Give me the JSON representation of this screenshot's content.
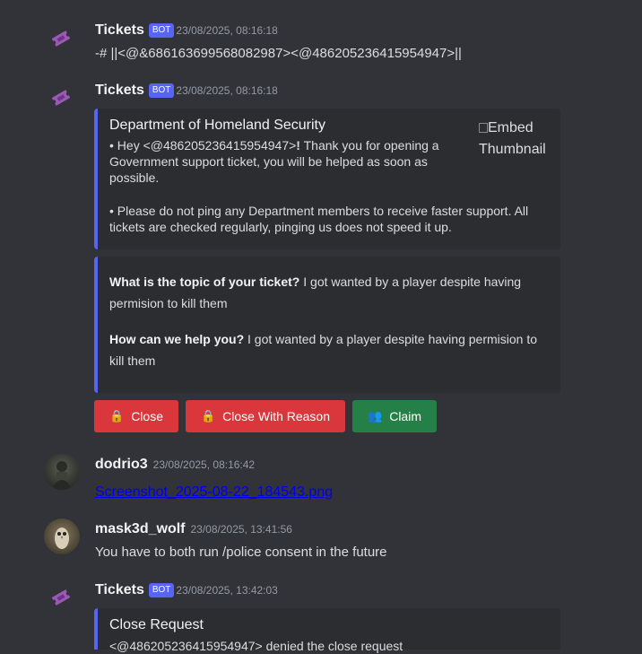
{
  "messages": [
    {
      "author": "Tickets",
      "bot_badge": "BOT",
      "timestamp": "23/08/2025, 08:16:18",
      "text": "-# ||<@&686163699568082987><@486205236415954947>||"
    },
    {
      "author": "Tickets",
      "bot_badge": "BOT",
      "timestamp": "23/08/2025, 08:16:18",
      "embed1": {
        "title": "Department of Homeland Security",
        "desc_line1_pre": "• Hey <@486205236415954947>",
        "desc_line1_bold": "!",
        "desc_line1_post": " Thank you for opening a Government support ticket, you will be helped as soon as possible.",
        "desc_line2": "• Please do not ping any Department members to receive faster support. All tickets are checked regularly, pinging us does not speed it up.",
        "thumbnail_alt": "Embed Thumbnail"
      },
      "embed2": {
        "q1_label": "What is the topic of your ticket?",
        "q1_answer": " I got wanted by a player despite having permision to kill them",
        "q2_label": "How can we help you?",
        "q2_answer": " I got wanted by a player despite having permision to kill them"
      },
      "buttons": {
        "close": "Close",
        "close_reason": "Close With Reason",
        "claim": "Claim"
      }
    },
    {
      "author": "dodrio3",
      "timestamp": "23/08/2025, 08:16:42",
      "link": "Screenshot_2025-08-22_184543.png"
    },
    {
      "author": "mask3d_wolf",
      "timestamp": "23/08/2025, 13:41:56",
      "text": "You have to both run /police consent in the future"
    },
    {
      "author": "Tickets",
      "bot_badge": "BOT",
      "timestamp": "23/08/2025, 13:42:03",
      "embed": {
        "title": "Close Request",
        "desc": "<@486205236415954947> denied the close request"
      }
    }
  ],
  "colors": {
    "background": "#313338",
    "embed_bg": "#2b2d31",
    "embed_border": "#5865f2",
    "danger": "#da373c",
    "success": "#248046",
    "ticket_icon": "#9b59b6"
  },
  "icons": {
    "ticket": "ticket-icon",
    "lock": "lock-icon",
    "claim": "people-icon"
  }
}
